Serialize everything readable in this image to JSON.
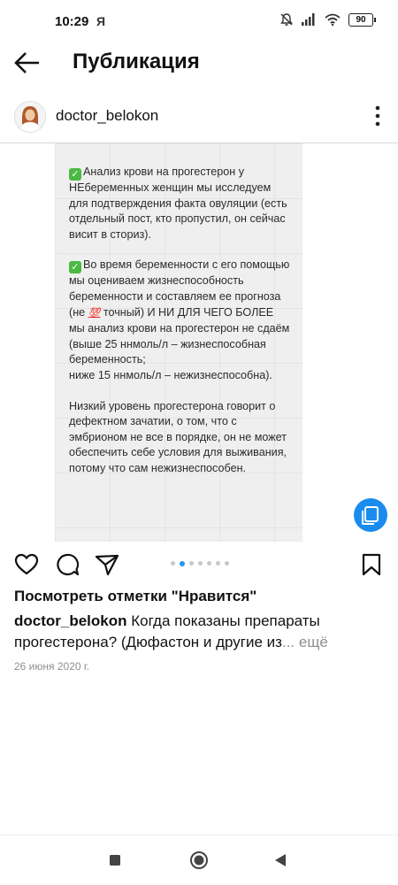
{
  "status": {
    "time": "10:29",
    "ya": "Я",
    "battery": "90"
  },
  "header": {
    "title": "Публикация"
  },
  "author": {
    "username": "doctor_belokon"
  },
  "post": {
    "para1": "Анализ крови на прогестерон у НЕбеременных женщин мы исследуем для подтверждения факта овуляции (есть отдельный пост, кто пропустил, он сейчас висит в сториз).",
    "para2_a": "Во время беременности с его помощью мы оцениваем жизнеспособность беременности и составляем ее прогноза (не ",
    "emoji": "💯",
    "para2_b": " точный) И НИ ДЛЯ ЧЕГО БОЛЕЕ мы анализ крови на прогестерон не сдаём (выше 25 ннмоль/л – жизнеспособная беременность;",
    "para2_c": "ниже 15 ннмоль/л – нежизнеспособна).",
    "para3": "Низкий уровень прогестерона говорит о дефектном зачатии, о том, что с эмбрионом не все в порядке, он не может обеспечить себе условия для выживания, потому что сам нежизнеспособен."
  },
  "carousel": {
    "total": 7,
    "active": 1
  },
  "likes_label": "Посмотреть отметки \"Нравится\"",
  "caption": {
    "username": "doctor_belokon",
    "text": " Когда показаны препараты прогестерона? (Дюфастон и другие из",
    "ellipsis": "...",
    "more": " ещё"
  },
  "date": "26 июня 2020 г.",
  "colors": {
    "accent": "#1a8cf0",
    "active_dot": "#2196f3",
    "check": "#4cb944"
  }
}
